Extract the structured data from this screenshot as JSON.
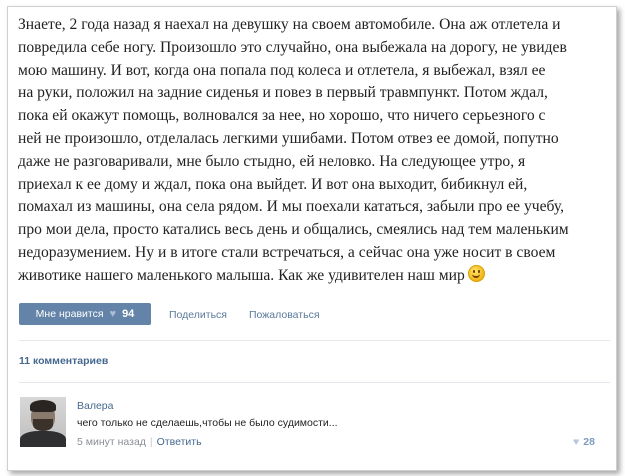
{
  "post": {
    "lines": [
      "Знаете, 2 года назад я наехал на девушку на своем автомобиле. Она аж отлетела и",
      "повредила себе ногу. Произошло это случайно, она выбежала на дорогу, не увидев",
      "мою машину. И вот, когда она попала под колеса и отлетела, я выбежал, взял ее",
      "на руки, положил на задние сиденья и повез в первый травмпункт. Потом ждал,",
      "пока ей окажут помощь, волновался за нее, но хорошо, что ничего серьезного с",
      "ней не произошло, отделалась легкими ушибами. Потом отвез ее домой, попутно",
      "даже не разговаривали, мне было стыдно, ей неловко. На следующее утро, я",
      "приехал к ее дому и ждал, пока она выйдет. И вот она выходит, бибикнул ей,",
      "помахал из машины, она села рядом. И мы поехали кататься, забыли про ее учебу,",
      "про мои дела, просто катались весь день и общались, смеялись над тем маленьким",
      "недоразумением. Ну и в итоге стали встречаться, а сейчас она уже носит в своем",
      "животике нашего маленького малыша. Как же удивителен наш мир"
    ],
    "end_icon": "smile-emoji-icon"
  },
  "actions": {
    "like_label": "Мне нравится",
    "like_icon": "heart-icon",
    "like_count": "94",
    "share_label": "Поделиться",
    "report_label": "Пожаловаться"
  },
  "comments": {
    "count_label": "11 комментариев",
    "items": [
      {
        "author": "Валера",
        "text": "чего только не сделаешь,чтобы не было судимости...",
        "time": "5 минут назад",
        "reply_label": "Ответить",
        "likes": "28"
      }
    ]
  },
  "colors": {
    "accent": "#6383a8",
    "link": "#45688e",
    "muted": "#8a8f95"
  }
}
